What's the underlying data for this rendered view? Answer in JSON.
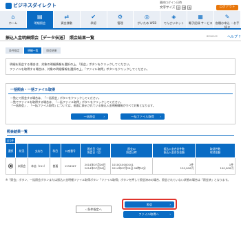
{
  "header": {
    "logo_text": "ビジネスダイレクト",
    "user_line1": "最終ログイン日時",
    "fontsize_label": "文字サイズ",
    "fontsize_small": "小",
    "fontsize_medium": "中",
    "fontsize_large": "大",
    "logout_label": "ログアウト"
  },
  "nav": {
    "items": [
      {
        "label": "ホーム",
        "icon": "home-icon"
      },
      {
        "label": "明細照会",
        "icon": "document-icon"
      },
      {
        "label": "資金移動",
        "icon": "transfer-icon"
      },
      {
        "label": "承認",
        "icon": "check-icon"
      },
      {
        "label": "管理",
        "icon": "gear-icon"
      },
      {
        "label": "がいため WEB",
        "icon": "globe-icon"
      },
      {
        "label": "でんさいネット",
        "icon": "network-icon"
      },
      {
        "label": "電子記録 サービス",
        "icon": "file-icon"
      },
      {
        "label": "各種お申込 ・お手続き",
        "icon": "form-icon"
      }
    ]
  },
  "page": {
    "title": "振込入金明細照会［データ伝送］　照会結果一覧",
    "screen_id": "BFN0002",
    "help_label": "ヘルプ"
  },
  "steps": [
    "条件指定",
    "明細一覧",
    "照会結果"
  ],
  "description": {
    "line1": "明細を照会する場合は、対象の明細情報を選択の上、「照会」ボタンをクリックしてください。",
    "line2": "ファイルを取得する場合は、対象の明細情報を選択の上、「ファイル取得」ボタンをクリックしてください。"
  },
  "bulk": {
    "title": "一括照会・一括ファイル取得",
    "line1": "一覧にて照会する場合は、「一括照会」ボタンをクリックしてください。",
    "line2": "一覧でファイルを取得する場合は、「一括ファイル取得」ボタンをクリックしてください。",
    "line3": "「一括照会」、「一括ファイル取得」については、画面に表示されている振込入金明細情報がすべて対象となります。",
    "bulk_inquiry_label": "一括照会",
    "bulk_file_label": "一括ファイル取得"
  },
  "results": {
    "title": "照会結果一覧",
    "count_label": "全1件",
    "columns": [
      "選択",
      "状況",
      "支店名",
      "科目",
      "口座番号",
      "照会日（自）\n照会日（至）",
      "照会ID\n照会日時",
      "振込入金合計件数\n振込入金合計金額",
      "取消件数\n取消金額"
    ],
    "rows": [
      {
        "status": "未照会",
        "branch": "本店（211）",
        "subject": "普通",
        "account": "1234567",
        "date_from": "2014年07月26日",
        "date_to": "2014年07月26日",
        "inquiry_id": "1010010000101",
        "inquiry_datetime": "2014年07月26日 09時30分",
        "total_count": "2件",
        "total_amount": "120,000円",
        "cancel_count": "1件",
        "cancel_amount": "100,000円"
      }
    ]
  },
  "note": "※「照会」ボタン、一括照会ボタンまたは振込入金明細ファイル取得ボタン「ファイル取得」ボタンを押して照会済みの場合、照会されていない状態の場合は「照会済」となります。",
  "buttons": {
    "back_label": "条件指定へ",
    "inquiry_label": "照会",
    "file_label": "ファイル取得へ"
  },
  "colors": {
    "primary": "#0a6cc4",
    "highlight": "#e0332c",
    "logout": "#e8760a"
  }
}
